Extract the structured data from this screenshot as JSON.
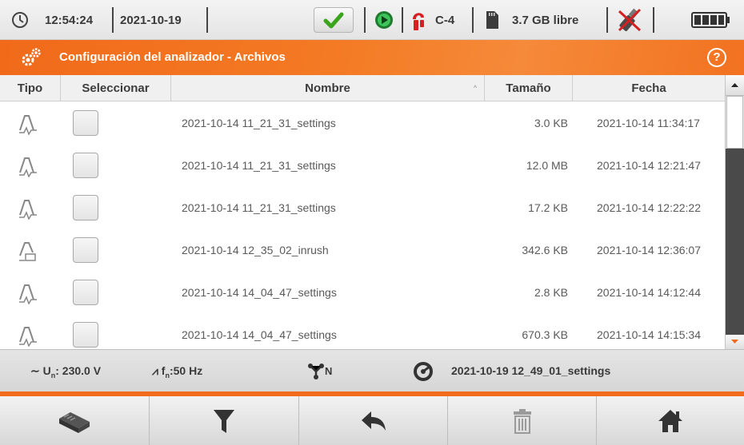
{
  "status": {
    "time": "12:54:24",
    "date": "2021-10-19",
    "clamp_label": "C-4",
    "storage_free": "3.7 GB libre"
  },
  "title": {
    "text": "Configuración del analizador - Archivos",
    "help_symbol": "?"
  },
  "table": {
    "columns": [
      "Tipo",
      "Seleccionar",
      "Nombre",
      "Tamaño",
      "Fecha"
    ],
    "sort_indicator": "^",
    "rows": [
      {
        "type": "settings",
        "name": "2021-10-14 11_21_31_settings",
        "size": "3.0 KB",
        "date": "2021-10-14 11:34:17"
      },
      {
        "type": "settings",
        "name": "2021-10-14 11_21_31_settings",
        "size": "12.0 MB",
        "date": "2021-10-14 12:21:47"
      },
      {
        "type": "settings",
        "name": "2021-10-14 11_21_31_settings",
        "size": "17.2 KB",
        "date": "2021-10-14 12:22:22"
      },
      {
        "type": "inrush",
        "name": "2021-10-14 12_35_02_inrush",
        "size": "342.6 KB",
        "date": "2021-10-14 12:36:07"
      },
      {
        "type": "settings",
        "name": "2021-10-14 14_04_47_settings",
        "size": "2.8 KB",
        "date": "2021-10-14 14:12:44"
      },
      {
        "type": "settings",
        "name": "2021-10-14 14_04_47_settings",
        "size": "670.3 KB",
        "date": "2021-10-14 14:15:34"
      }
    ]
  },
  "info": {
    "voltage_prefix": "U",
    "voltage_sub": "n",
    "voltage_value": ": 230.0 V",
    "freq_prefix": "f",
    "freq_sub": "n",
    "freq_value": ":50 Hz",
    "network_sub": "N",
    "active_settings": "2021-10-19 12_49_01_settings"
  },
  "toolbar": {
    "buttons": [
      "storage-icon",
      "filter-icon",
      "back-icon",
      "trash-icon",
      "home-icon"
    ]
  },
  "colors": {
    "accent": "#f26a1b",
    "ok_green": "#3aa51c",
    "clamp_red": "#d42020"
  }
}
